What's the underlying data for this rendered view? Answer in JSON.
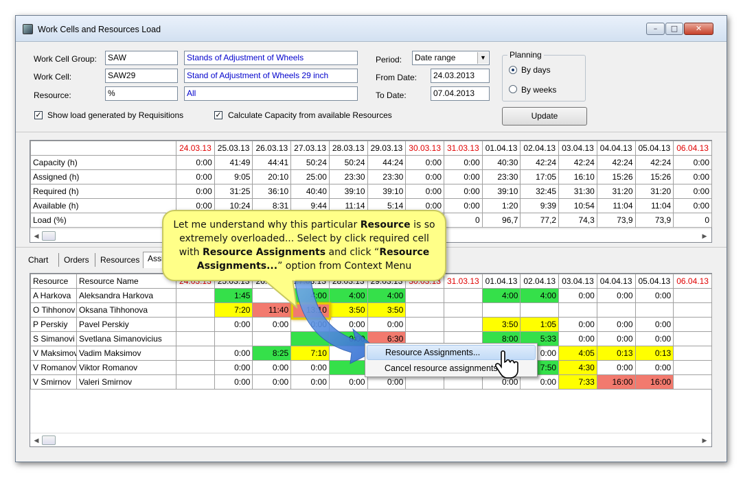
{
  "window": {
    "title": "Work Cells and Resources Load",
    "min": "–",
    "max": "□",
    "close": "✕"
  },
  "form": {
    "work_cell_group": {
      "label": "Work Cell Group:",
      "code": "SAW",
      "name": "Stands of Adjustment of Wheels"
    },
    "work_cell": {
      "label": "Work Cell:",
      "code": "SAW29",
      "name": "Stand of Adjustment of Wheels 29 inch"
    },
    "resource": {
      "label": "Resource:",
      "code": "%",
      "name": "All"
    },
    "show_requisitions": {
      "label": "Show load generated by Requisitions",
      "checked": true
    },
    "calc_capacity": {
      "label": "Calculate Capacity from available Resources",
      "checked": true
    },
    "period": {
      "label": "Period:",
      "value": "Date range"
    },
    "from_date": {
      "label": "From Date:",
      "value": "24.03.2013"
    },
    "to_date": {
      "label": "To Date:",
      "value": "07.04.2013"
    },
    "planning": {
      "title": "Planning",
      "by_days": "By days",
      "by_weeks": "By weeks",
      "selected": "By days"
    },
    "update_button": "Update",
    "check_mark": "✓"
  },
  "dates": [
    "24.03.13",
    "25.03.13",
    "26.03.13",
    "27.03.13",
    "28.03.13",
    "29.03.13",
    "30.03.13",
    "31.03.13",
    "01.04.13",
    "02.04.13",
    "03.04.13",
    "04.04.13",
    "05.04.13",
    "06.04.13"
  ],
  "weekend_flags": [
    true,
    false,
    false,
    false,
    false,
    false,
    true,
    true,
    false,
    false,
    false,
    false,
    false,
    true
  ],
  "summary": {
    "rows": [
      {
        "label": "Capacity (h)",
        "values": [
          "0:00",
          "41:49",
          "44:41",
          "50:24",
          "50:24",
          "44:24",
          "0:00",
          "0:00",
          "40:30",
          "42:24",
          "42:24",
          "42:24",
          "42:24",
          "0:00"
        ]
      },
      {
        "label": "Assigned (h)",
        "values": [
          "0:00",
          "9:05",
          "20:10",
          "25:00",
          "23:30",
          "23:30",
          "0:00",
          "0:00",
          "23:30",
          "17:05",
          "16:10",
          "15:26",
          "15:26",
          "0:00"
        ]
      },
      {
        "label": "Required (h)",
        "values": [
          "0:00",
          "31:25",
          "36:10",
          "40:40",
          "39:10",
          "39:10",
          "0:00",
          "0:00",
          "39:10",
          "32:45",
          "31:30",
          "31:20",
          "31:20",
          "0:00"
        ]
      },
      {
        "label": "Available (h)",
        "values": [
          "0:00",
          "10:24",
          "8:31",
          "9:44",
          "11:14",
          "5:14",
          "0:00",
          "0:00",
          "1:20",
          "9:39",
          "10:54",
          "11:04",
          "11:04",
          "0:00"
        ]
      },
      {
        "label": "Load (%)",
        "values": [
          "",
          "",
          "",
          "",
          "",
          "",
          "",
          "0",
          "96,7",
          "77,2",
          "74,3",
          "73,9",
          "73,9",
          "0"
        ]
      }
    ]
  },
  "tabs": [
    "Chart",
    "Orders",
    "Resources",
    "Assi"
  ],
  "assignments": {
    "headers": {
      "resource": "Resource",
      "name": "Resource Name"
    },
    "rows": [
      {
        "resource": "A Harkova",
        "name": "Aleksandra Harkova",
        "cells": [
          "",
          "1:45",
          "",
          "4:00",
          "4:00",
          "4:00",
          "",
          "",
          "4:00",
          "4:00",
          "0:00",
          "0:00",
          "0:00",
          ""
        ],
        "colors": [
          "",
          "g",
          "",
          "g",
          "g",
          "g",
          "",
          "",
          "g",
          "g",
          "",
          "",
          "",
          ""
        ]
      },
      {
        "resource": "O Tihhonov",
        "name": "Oksana Tihhonova",
        "cells": [
          "",
          "7:20",
          "11:40",
          "13:10",
          "3:50",
          "3:50",
          "",
          "",
          "",
          "",
          "",
          "",
          "",
          ""
        ],
        "colors": [
          "",
          "y",
          "rd",
          "rd",
          "y",
          "y",
          "",
          "",
          "",
          "",
          "",
          "",
          "",
          ""
        ]
      },
      {
        "resource": "P Perskiy",
        "name": "Pavel Perskiy",
        "cells": [
          "",
          "0:00",
          "0:00",
          "0:00",
          "0:00",
          "0:00",
          "",
          "",
          "3:50",
          "1:05",
          "0:00",
          "0:00",
          "0:00",
          ""
        ],
        "colors": [
          "",
          "",
          "",
          "",
          "",
          "",
          "",
          "",
          "y",
          "y",
          "",
          "",
          "",
          ""
        ]
      },
      {
        "resource": "S Simanovi",
        "name": "Svetlana Simanovicius",
        "cells": [
          "",
          "",
          "",
          "",
          "0:00",
          "6:30",
          "",
          "",
          "8:00",
          "5:33",
          "0:00",
          "0:00",
          "0:00",
          ""
        ],
        "colors": [
          "",
          "",
          "",
          "g",
          "g",
          "rd",
          "",
          "",
          "g",
          "g",
          "",
          "",
          "",
          ""
        ]
      },
      {
        "resource": "V Maksimov",
        "name": "Vadim Maksimov",
        "cells": [
          "",
          "0:00",
          "8:25",
          "7:10",
          "",
          "",
          "",
          "",
          "",
          "0:00",
          "4:05",
          "0:13",
          "0:13",
          ""
        ],
        "colors": [
          "",
          "",
          "g",
          "y",
          "",
          "",
          "",
          "",
          "",
          "",
          "y",
          "y",
          "y",
          ""
        ]
      },
      {
        "resource": "V Romanov",
        "name": "Viktor Romanov",
        "cells": [
          "",
          "0:00",
          "0:00",
          "0:00",
          "",
          "",
          "",
          "",
          "",
          "7:50",
          "4:30",
          "0:00",
          "0:00",
          ""
        ],
        "colors": [
          "",
          "",
          "",
          "",
          "g",
          "",
          "",
          "",
          "",
          "g",
          "y",
          "",
          "",
          ""
        ]
      },
      {
        "resource": "V Smirnov",
        "name": "Valeri Smirnov",
        "cells": [
          "",
          "0:00",
          "0:00",
          "0:00",
          "0:00",
          "0:00",
          "",
          "",
          "0:00",
          "0:00",
          "7:33",
          "16:00",
          "16:00",
          ""
        ],
        "colors": [
          "",
          "",
          "",
          "",
          "",
          "",
          "",
          "",
          "",
          "",
          "y",
          "rd",
          "rd",
          ""
        ]
      }
    ]
  },
  "callout": {
    "p1": "Let me understand why this particular ",
    "b1": "Resource",
    "p2": " is so extremely overloaded... Select by click required cell with ",
    "b2": "Resource Assignments",
    "p3": " and click “",
    "b3": "Resource Assignments...",
    "p4": "” option from Context Menu"
  },
  "context_menu": {
    "items": [
      "Resource Assignments...",
      "Cancel resource assignments"
    ],
    "highlighted": "Resource Assignments..."
  },
  "colors": {
    "green": "#35e04a",
    "yellow": "#ffff00",
    "red": "#f27a6e",
    "weekend": "#e00000"
  }
}
